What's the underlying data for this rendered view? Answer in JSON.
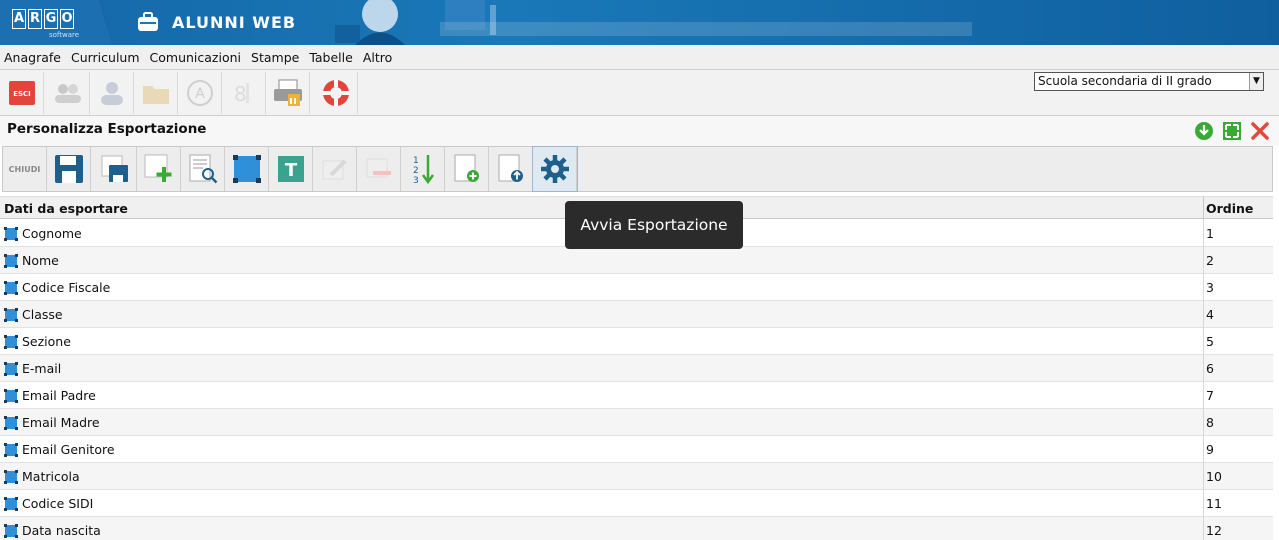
{
  "header": {
    "logo_letters": [
      "A",
      "R",
      "G",
      "O"
    ],
    "logo_subtitle": "software",
    "app_title": "ALUNNI WEB"
  },
  "menu": [
    "Anagrafe",
    "Curriculum",
    "Comunicazioni",
    "Stampe",
    "Tabelle",
    "Altro"
  ],
  "main_toolbar": {
    "exit_label": "ESCI",
    "school_select": "Scuola secondaria di II grado"
  },
  "panel": {
    "title": "Personalizza Esportazione",
    "close_label": "CHIUDI"
  },
  "grid": {
    "col_field": "Dati da esportare",
    "col_order": "Ordine",
    "rows": [
      {
        "field": "Cognome",
        "order": "1"
      },
      {
        "field": "Nome",
        "order": "2"
      },
      {
        "field": "Codice Fiscale",
        "order": "3"
      },
      {
        "field": "Classe",
        "order": "4"
      },
      {
        "field": "Sezione",
        "order": "5"
      },
      {
        "field": "E-mail",
        "order": "6"
      },
      {
        "field": "Email Padre",
        "order": "7"
      },
      {
        "field": "Email Madre",
        "order": "8"
      },
      {
        "field": "Email Genitore",
        "order": "9"
      },
      {
        "field": "Matricola",
        "order": "10"
      },
      {
        "field": "Codice SIDI",
        "order": "11"
      },
      {
        "field": "Data nascita",
        "order": "12"
      }
    ]
  },
  "tooltip": "Avvia Esportazione",
  "colors": {
    "banner": "#1a78b8",
    "accent_blue": "#2f8fd8",
    "green": "#3aaa35",
    "red": "#e04a3a"
  }
}
